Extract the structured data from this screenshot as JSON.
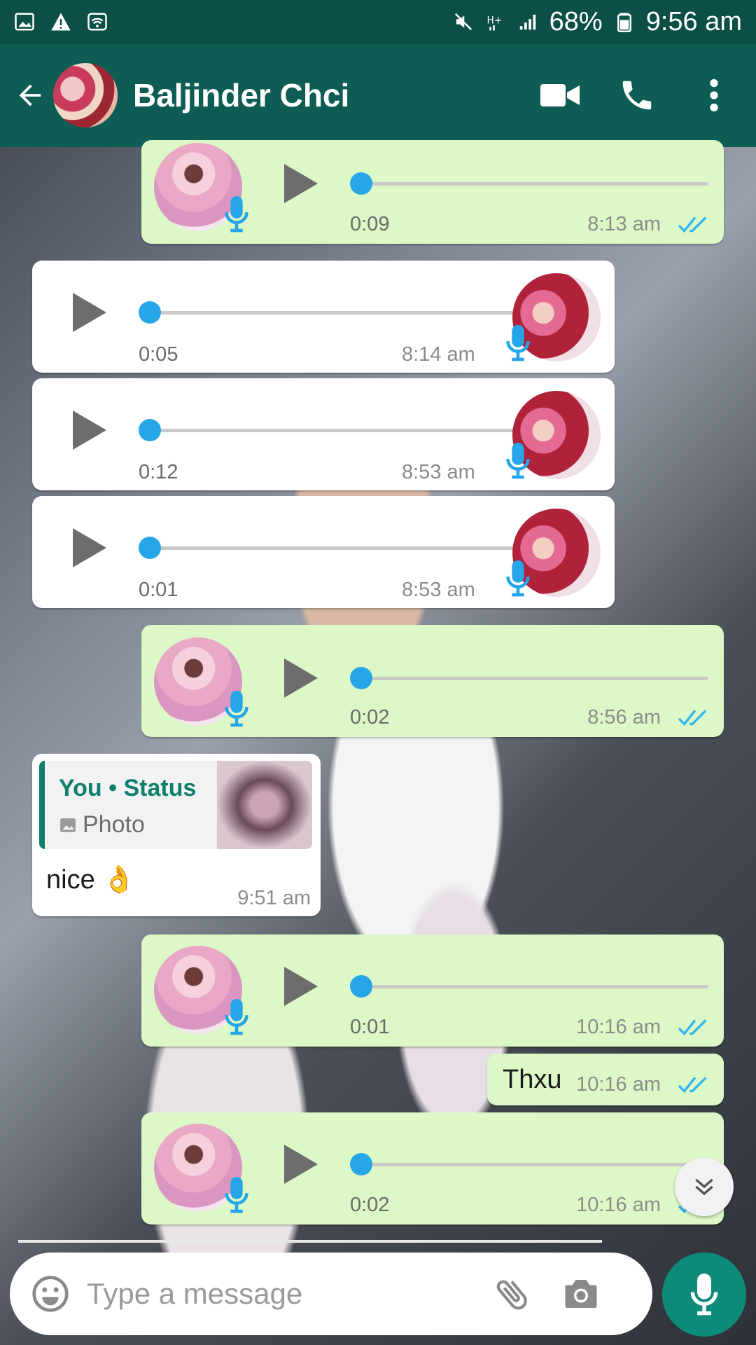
{
  "status_bar": {
    "battery": "68%",
    "clock": "9:56 am"
  },
  "header": {
    "contact_name": "Baljinder Chci"
  },
  "messages": [
    {
      "kind": "voice",
      "dir": "out",
      "duration": "0:09",
      "time": "8:13 am"
    },
    {
      "kind": "voice",
      "dir": "in",
      "duration": "0:05",
      "time": "8:14 am"
    },
    {
      "kind": "voice",
      "dir": "in",
      "duration": "0:12",
      "time": "8:53 am"
    },
    {
      "kind": "voice",
      "dir": "in",
      "duration": "0:01",
      "time": "8:53 am"
    },
    {
      "kind": "voice",
      "dir": "out",
      "duration": "0:02",
      "time": "8:56 am"
    },
    {
      "kind": "reply",
      "dir": "in",
      "quote_name": "You • Status",
      "quote_type": "Photo",
      "text": "nice 👌",
      "time": "9:51 am"
    },
    {
      "kind": "voice",
      "dir": "out",
      "duration": "0:01",
      "time": "10:16 am"
    },
    {
      "kind": "text",
      "dir": "out",
      "text": "Thxu",
      "time": "10:16 am"
    },
    {
      "kind": "voice",
      "dir": "out",
      "duration": "0:02",
      "time": "10:16 am"
    }
  ],
  "composer": {
    "placeholder": "Type a message"
  },
  "colors": {
    "header": "#0e5d54",
    "outgoing": "#dcf8c6",
    "accent": "#26a6e8",
    "fab": "#0e8a7a"
  },
  "icons": [
    "back-arrow-icon",
    "video-call-icon",
    "phone-icon",
    "more-icon",
    "mic-icon",
    "play-icon",
    "double-check-icon",
    "emoji-icon",
    "attach-icon",
    "camera-icon",
    "chevron-down-icon"
  ]
}
